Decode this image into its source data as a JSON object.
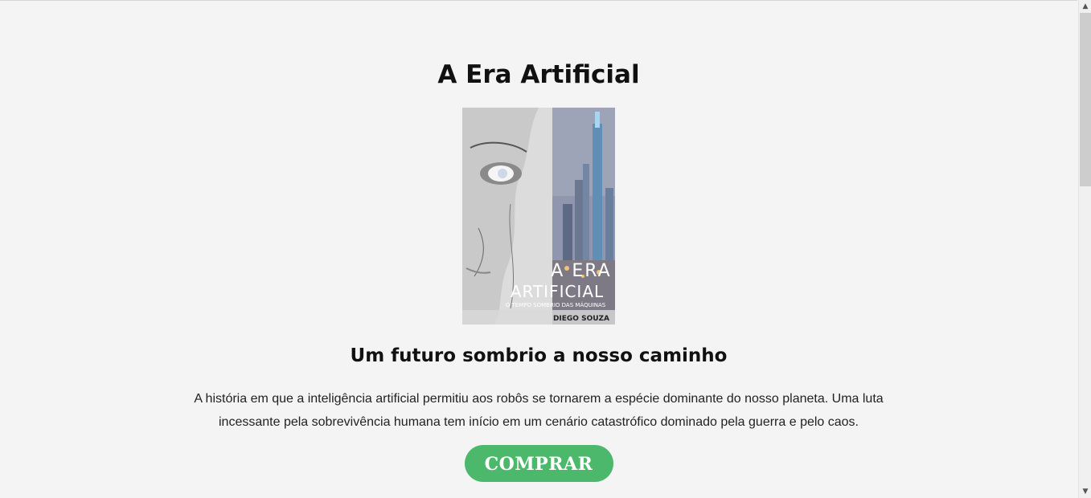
{
  "page": {
    "title": "A Era Artificial",
    "subtitle": "Um futuro sombrio a nosso caminho",
    "description": "A história em que a inteligência artificial permitiu aos robôs se tornarem a espécie dominante do nosso planeta. Uma luta incessante pela sobrevivência humana tem início em um cenário catastrófico dominado pela guerra e pelo caos.",
    "buy_label": "COMPRAR"
  },
  "cover": {
    "title_line1": "A ERA",
    "title_line2": "ARTIFICIAL",
    "tagline": "O TEMPO SOMBRIO DAS MÁQUINAS",
    "author": "DIEGO SOUZA"
  },
  "colors": {
    "background": "#f4f4f4",
    "button": "#4cb86b",
    "text": "#111111"
  },
  "scrollbar": {
    "up_icon": "scroll-up-arrow-icon",
    "down_icon": "scroll-down-arrow-icon"
  }
}
